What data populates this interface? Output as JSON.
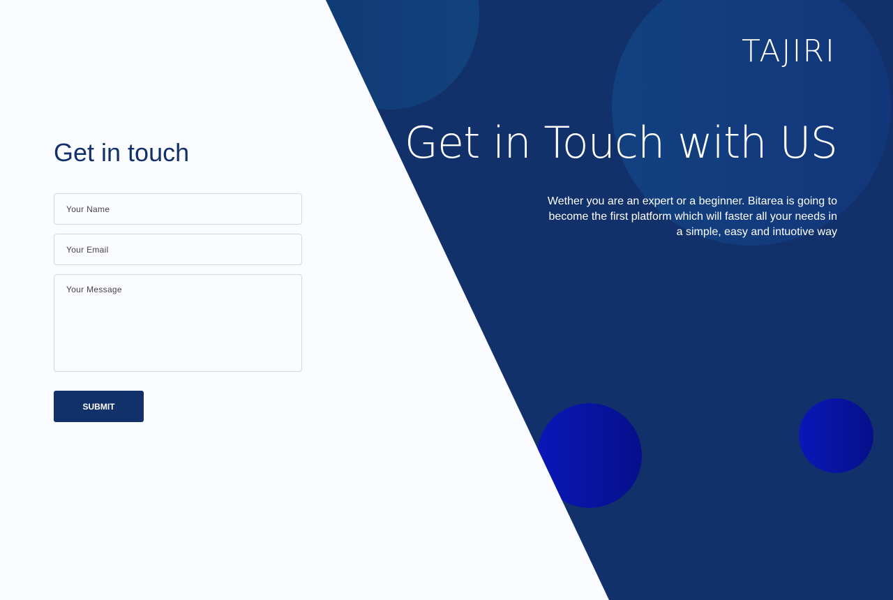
{
  "brand": {
    "logo": "TAJIRI"
  },
  "hero": {
    "title": "Get in Touch with US",
    "description": "Wether you are an expert or a beginner. Bitarea is going to become the first platform which will faster all your needs in a simple, easy and intuotive way"
  },
  "form": {
    "title": "Get in touch",
    "name_placeholder": "Your Name",
    "email_placeholder": "Your Email",
    "message_placeholder": "Your Message",
    "submit_label": "SUBMIT"
  },
  "colors": {
    "primary": "#12316b",
    "background": "#fbfcff",
    "accent_circle": "#0b17b8"
  }
}
